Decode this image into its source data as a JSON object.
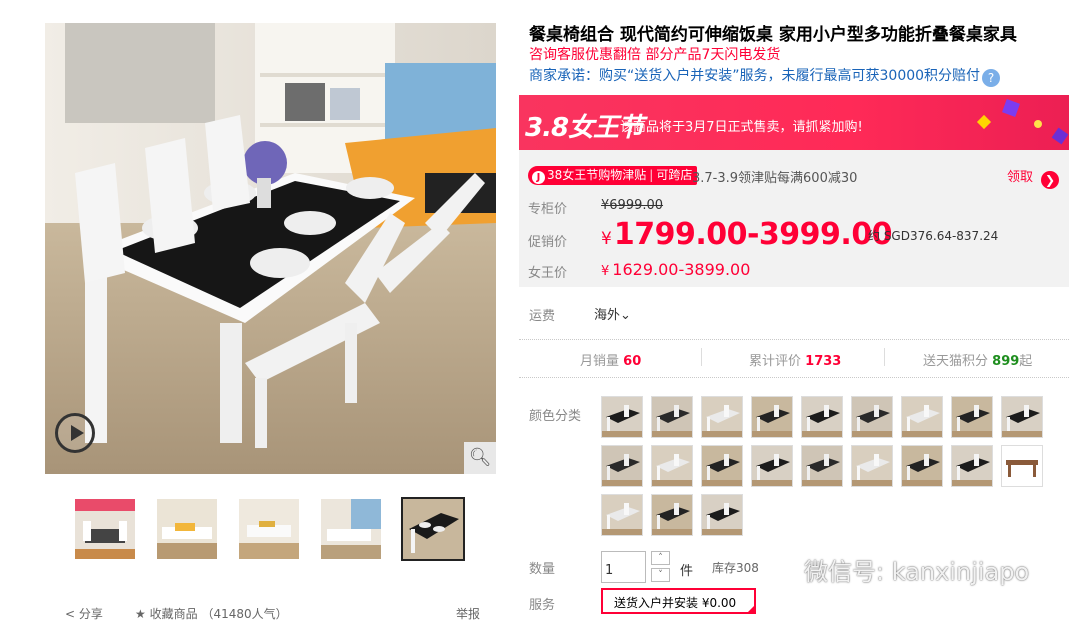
{
  "product": {
    "title": "餐桌椅组合 现代简约可伸缩饭桌 家用小户型多功能折叠餐桌家具",
    "subtitle": "咨询客服优惠翻倍 部分产品7天闪电发货",
    "promise": "商家承诺：购买“送货入户并安装”服务，未履行最高可获30000积分赔付",
    "help_icon": "?"
  },
  "banner": {
    "logo": "3.8女王节",
    "text": "该商品将于3月7日正式售卖，请抓紧加购!"
  },
  "coupon": {
    "tag_main": "38女王节购物津贴",
    "tag_sub": "可跨店",
    "text": "3.7-3.9领津贴每满600减30",
    "claim": "领取"
  },
  "price": {
    "original_label": "专柜价",
    "original": "¥6999.00",
    "sale_label": "促销价",
    "currency": "¥",
    "sale": "1799.00-3999.00",
    "sgd": "约 SGD376.64-837.24",
    "queen_label": "女王价",
    "queen": "1629.00-3899.00"
  },
  "shipping": {
    "label": "运费",
    "value": "海外"
  },
  "stats": {
    "monthly_sales_label": "月销量",
    "monthly_sales": "60",
    "reviews_label": "累计评价",
    "reviews": "1733",
    "points_label": "送天猫积分",
    "points": "899",
    "points_suffix": "起"
  },
  "colors": {
    "label": "颜色分类",
    "count": 21
  },
  "quantity": {
    "label": "数量",
    "value": "1",
    "unit": "件",
    "stock": "库存308"
  },
  "service": {
    "label": "服务",
    "option": "送货入户并安装 ¥0.00"
  },
  "gallery": {
    "thumb_count": 5,
    "active_thumb": 4,
    "share": "分享",
    "favorite": "收藏商品",
    "popularity": "（41480人气）",
    "report": "举报"
  },
  "watermark": {
    "text": "微信号: kanxinjiapo"
  },
  "colors_theme": {
    "accent": "#ff0036",
    "link_blue": "#1a64b8",
    "banner": "#ff2a57",
    "green": "#1e8e1e"
  }
}
